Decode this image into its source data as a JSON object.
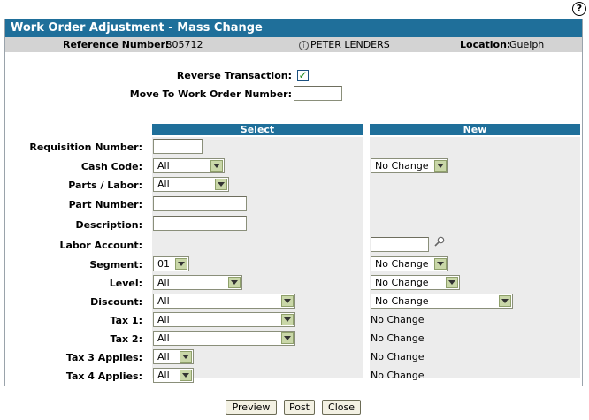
{
  "help_label": "?",
  "title": "Work Order Adjustment - Mass Change",
  "info": {
    "ref_label": "Reference Number:",
    "ref_value": "B05712",
    "user": "PETER LENDERS",
    "loc_label": "Location:",
    "loc_value": "Guelph"
  },
  "reverse_label": "Reverse Transaction:",
  "reverse_checked": true,
  "move_label": "Move To Work Order Number:",
  "move_value": "",
  "headers": {
    "select": "Select",
    "new": "New"
  },
  "rows": {
    "req": {
      "label": "Requisition Number:",
      "select_value": ""
    },
    "cash": {
      "label": "Cash Code:",
      "select_value": "All",
      "new_value": "No Change"
    },
    "parts": {
      "label": "Parts / Labor:",
      "select_value": "All"
    },
    "partnum": {
      "label": "Part Number:",
      "select_value": ""
    },
    "desc": {
      "label": "Description:",
      "select_value": ""
    },
    "labor": {
      "label": "Labor Account:",
      "new_value": ""
    },
    "segment": {
      "label": "Segment:",
      "select_value": "01",
      "new_value": "No Change"
    },
    "level": {
      "label": "Level:",
      "select_value": "All",
      "new_value": "No Change"
    },
    "discount": {
      "label": "Discount:",
      "select_value": "All",
      "new_value": "No Change"
    },
    "tax1": {
      "label": "Tax 1:",
      "select_value": "All",
      "new_value": "No Change"
    },
    "tax2": {
      "label": "Tax 2:",
      "select_value": "All",
      "new_value": "No Change"
    },
    "tax3": {
      "label": "Tax 3 Applies:",
      "select_value": "All",
      "new_value": "No Change"
    },
    "tax4": {
      "label": "Tax 4 Applies:",
      "select_value": "All",
      "new_value": "No Change"
    }
  },
  "buttons": {
    "preview": "Preview",
    "post": "Post",
    "close": "Close"
  },
  "icons": {
    "help": "help-icon",
    "info": "info-icon",
    "search": "magnifier-icon",
    "check": "checkmark-icon"
  },
  "colors": {
    "header": "#1f6f9a",
    "info_bar": "#d3d3d3",
    "cell": "#ececec"
  }
}
